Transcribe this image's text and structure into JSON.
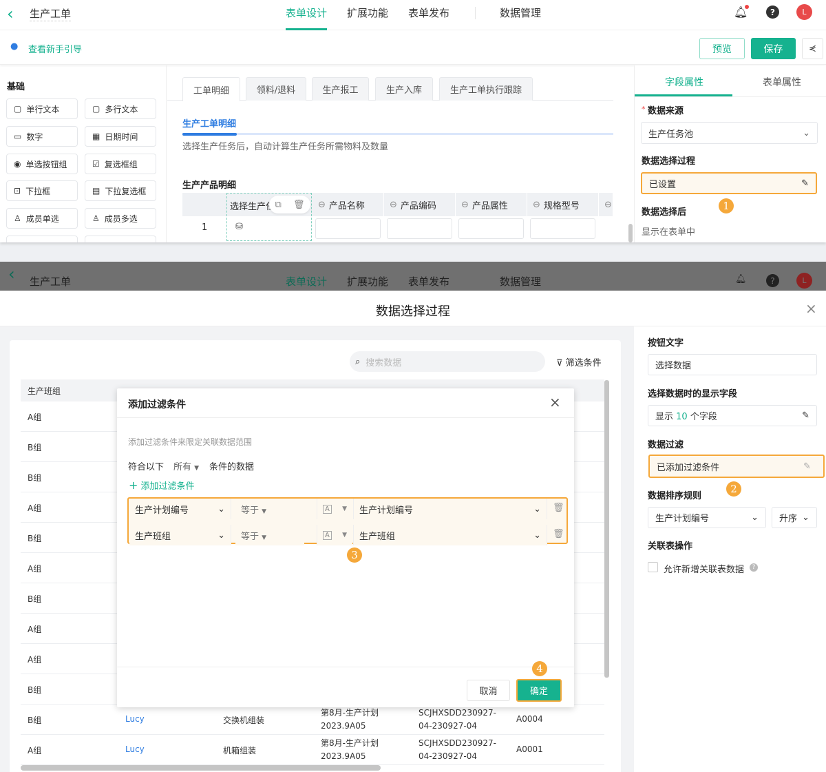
{
  "header": {
    "back": "back",
    "title": "生产工单",
    "tabs": [
      "表单设计",
      "扩展功能",
      "表单发布",
      "数据管理"
    ],
    "avatar": "L"
  },
  "toolbar": {
    "guide": "查看新手引导",
    "preview": "预览",
    "save": "保存"
  },
  "palette": {
    "section": "基础",
    "items": [
      "单行文本",
      "多行文本",
      "数字",
      "日期时间",
      "单选按钮组",
      "复选框组",
      "下拉框",
      "下拉复选框",
      "成员单选",
      "成员多选"
    ]
  },
  "form_tabs": [
    "工单明细",
    "领料/退料",
    "生产报工",
    "生产入库",
    "生产工单执行跟踪"
  ],
  "section": {
    "title": "生产工单明细",
    "desc": "选择生产任务后，自动计算生产任务所需物料及数量",
    "sub": "生产产品明细"
  },
  "subtable": {
    "headers": [
      "选择生产任",
      "产品名称",
      "产品编码",
      "产品属性",
      "规格型号"
    ],
    "row_no": "1"
  },
  "props": {
    "tabs": [
      "字段属性",
      "表单属性"
    ],
    "source_label": "数据来源",
    "source_value": "生产任务池",
    "process_label": "数据选择过程",
    "process_value": "已设置",
    "after_label": "数据选择后",
    "after_value": "显示在表单中"
  },
  "dialog": {
    "title": "数据选择过程",
    "search_placeholder": "搜索数据",
    "filter": "筛选条件"
  },
  "data_table": {
    "header": "生产班组",
    "groups": [
      "A组",
      "B组",
      "B组",
      "A组",
      "B组",
      "A组",
      "B组",
      "A组",
      "A组",
      "B组"
    ],
    "rows": [
      [
        "B组",
        "Lucy",
        "交换机组装",
        "第8月-生产计划\n2023.9A05",
        "SCJHXSDD230927-\n04-230927-04",
        "A0004"
      ],
      [
        "A组",
        "Lucy",
        "机箱组装",
        "第8月-生产计划\n2023.9A05",
        "SCJHXSDD230927-\n04-230927-04",
        "A0001"
      ]
    ]
  },
  "filter_modal": {
    "title": "添加过滤条件",
    "hint": "添加过滤条件来限定关联数据范围",
    "match_prefix": "符合以下",
    "match_mode": "所有",
    "match_suffix": "条件的数据",
    "add": "添加过滤条件",
    "conditions": [
      {
        "field": "生产计划编号",
        "op": "等于",
        "value": "生产计划编号"
      },
      {
        "field": "生产班组",
        "op": "等于",
        "value": "生产班组"
      }
    ],
    "cancel": "取消",
    "ok": "确定"
  },
  "side": {
    "btn_label": "按钮文字",
    "btn_value": "选择数据",
    "display_label": "选择数据时的显示字段",
    "display_pre": "显示",
    "display_count": "10",
    "display_post": "个字段",
    "filter_label": "数据过滤",
    "filter_value": "已添加过滤条件",
    "sort_label": "数据排序规则",
    "sort_field": "生产计划编号",
    "sort_order": "升序",
    "rel_label": "关联表操作",
    "rel_check": "允许新增关联表数据"
  },
  "badges": [
    "1",
    "2",
    "3",
    "4"
  ],
  "colors": {
    "accent": "#16b28f",
    "highlight": "#f5a83a"
  }
}
